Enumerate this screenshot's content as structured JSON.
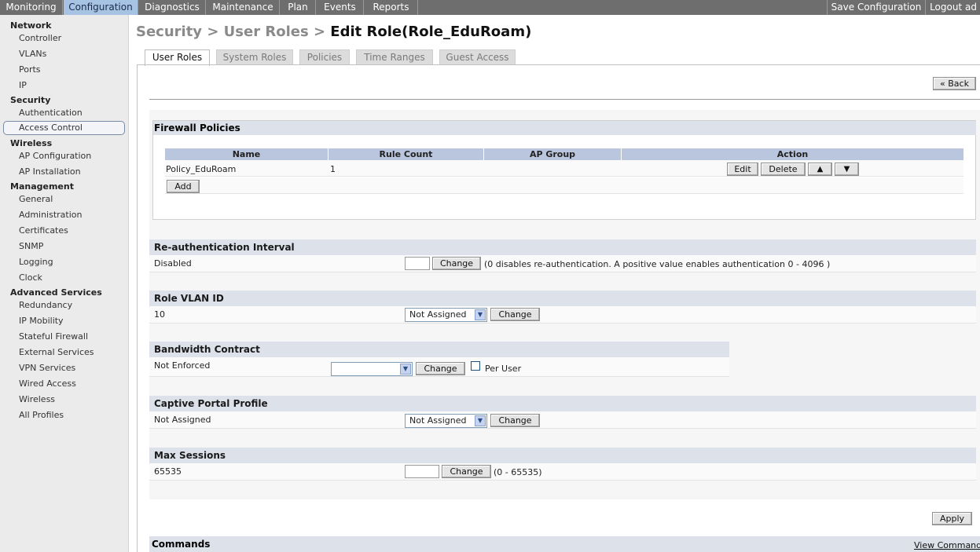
{
  "topnav": {
    "tabs": [
      "Monitoring",
      "Configuration",
      "Diagnostics",
      "Maintenance",
      "Plan",
      "Events",
      "Reports"
    ],
    "active_tab": "Configuration",
    "save_label": "Save Configuration",
    "logout_label": "Logout ad"
  },
  "sidebar": {
    "network": {
      "heading": "Network",
      "items": [
        "Controller",
        "VLANs",
        "Ports",
        "IP"
      ]
    },
    "security": {
      "heading": "Security",
      "items": [
        "Authentication",
        "Access Control"
      ]
    },
    "wireless": {
      "heading": "Wireless",
      "items": [
        "AP Configuration",
        "AP Installation"
      ]
    },
    "management": {
      "heading": "Management",
      "items": [
        "General",
        "Administration",
        "Certificates",
        "SNMP",
        "Logging",
        "Clock"
      ]
    },
    "advanced": {
      "heading": "Advanced Services",
      "items": [
        "Redundancy",
        "IP Mobility",
        "Stateful Firewall",
        "External Services",
        "VPN Services",
        "Wired Access",
        "Wireless",
        "All Profiles"
      ]
    },
    "active_item": "Access Control"
  },
  "title": {
    "crumb1": "Security",
    "sep": " > ",
    "crumb2": "User Roles",
    "current": "Edit Role(Role_EduRoam)"
  },
  "subtabs": [
    "User Roles",
    "System Roles",
    "Policies",
    "Time Ranges",
    "Guest Access"
  ],
  "back_label": "« Back",
  "firewall": {
    "heading": "Firewall Policies",
    "columns": [
      "Name",
      "Rule Count",
      "AP Group",
      "Action"
    ],
    "rows": [
      {
        "name": "Policy_EduRoam",
        "rule_count": "1",
        "ap_group": ""
      }
    ],
    "edit_label": "Edit",
    "delete_label": "Delete",
    "up_label": "▲",
    "down_label": "▼",
    "add_label": "Add"
  },
  "reauth": {
    "heading": "Re-authentication Interval",
    "value": "Disabled",
    "input_value": "",
    "change_label": "Change",
    "hint": "(0 disables re-authentication. A positive value enables authentication 0 - 4096 )"
  },
  "role_vlan": {
    "heading": "Role VLAN ID",
    "value": "10",
    "select_value": "Not Assigned",
    "change_label": "Change"
  },
  "bandwidth": {
    "heading": "Bandwidth Contract",
    "value": "Not Enforced",
    "select_value": "",
    "change_label": "Change",
    "per_user_label": "Per User"
  },
  "captive": {
    "heading": "Captive Portal Profile",
    "value": "Not Assigned",
    "select_value": "Not Assigned",
    "change_label": "Change"
  },
  "max_sessions": {
    "heading": "Max Sessions",
    "value": "65535",
    "input_value": "",
    "change_label": "Change",
    "hint": "(0 - 65535)"
  },
  "apply_label": "Apply",
  "commands": {
    "heading": "Commands",
    "view_label": "View Commands"
  },
  "colors": {
    "nav_bg": "#6e6e6e",
    "nav_active": "#a7c3e3",
    "section_head": "#dde2ea",
    "table_head": "#b9c6dd",
    "sidebar_bg": "#ebebeb"
  }
}
